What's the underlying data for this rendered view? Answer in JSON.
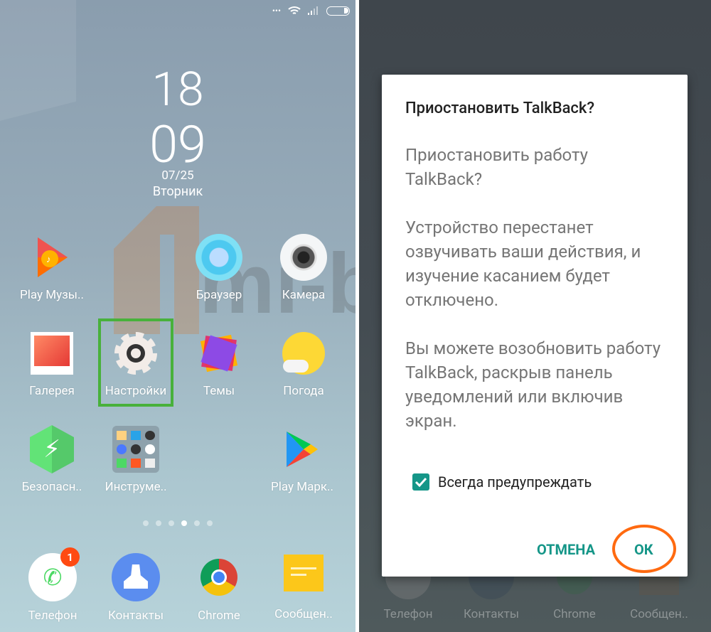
{
  "status_bar": {
    "icons": [
      "more-dots-icon",
      "wifi-icon",
      "signal-icon",
      "battery-icon"
    ]
  },
  "clock": {
    "hours": "18",
    "minutes": "09",
    "date": "07/25",
    "weekday": "Вторник"
  },
  "apps": [
    {
      "label": "Play Музы..",
      "icon": "play-music-icon"
    },
    {
      "label": "Браузер",
      "icon": "browser-icon"
    },
    {
      "label": "Камера",
      "icon": "camera-icon"
    },
    {
      "label": "Галерея",
      "icon": "gallery-icon"
    },
    {
      "label": "Настройки",
      "icon": "settings-gear-icon",
      "highlighted": true
    },
    {
      "label": "Темы",
      "icon": "themes-icon"
    },
    {
      "label": "Погода",
      "icon": "weather-icon"
    },
    {
      "label": "Безопасн..",
      "icon": "security-icon"
    },
    {
      "label": "Инструме..",
      "icon": "tools-folder-icon"
    },
    {
      "label": "Play Марк..",
      "icon": "play-store-icon"
    }
  ],
  "page_indicator": {
    "total": 6,
    "current": 4
  },
  "dock": [
    {
      "label": "Телефон",
      "icon": "phone-icon",
      "badge": "1"
    },
    {
      "label": "Контакты",
      "icon": "contacts-icon"
    },
    {
      "label": "Chrome",
      "icon": "chrome-icon"
    },
    {
      "label": "Сообщен..",
      "icon": "messages-icon"
    }
  ],
  "watermark": "mi-box.ru",
  "dialog": {
    "title": "Приостановить TalkBack?",
    "paragraphs": [
      "Приостановить работу TalkBack?",
      "Устройство перестанет озвучивать ваши действия, и изучение касанием будет отключено.",
      "Вы можете возобновить работу TalkBack, раскрыв панель уведомлений или включив экран."
    ],
    "checkbox_label": "Всегда предупреждать",
    "checkbox_checked": true,
    "cancel_label": "ОТМЕНА",
    "ok_label": "ОК"
  },
  "colors": {
    "accent": "#159688",
    "highlight_box": "#48b13b",
    "annotation_ring": "#ff6a10",
    "badge": "#ff4a12"
  }
}
